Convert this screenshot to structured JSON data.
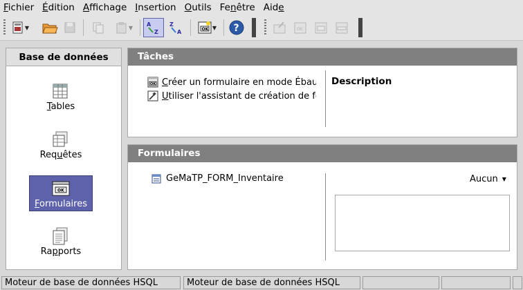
{
  "menubar": {
    "items": [
      {
        "pre": "",
        "u": "F",
        "post": "ichier"
      },
      {
        "pre": "",
        "u": "É",
        "post": "dition"
      },
      {
        "pre": "",
        "u": "A",
        "post": "ffichage"
      },
      {
        "pre": "",
        "u": "I",
        "post": "nsertion"
      },
      {
        "pre": "",
        "u": "O",
        "post": "utils"
      },
      {
        "pre": "Fe",
        "u": "n",
        "post": "être"
      },
      {
        "pre": "Aid",
        "u": "e",
        "post": ""
      }
    ]
  },
  "sidebar": {
    "title": "Base de données",
    "items": [
      {
        "pre": "",
        "u": "T",
        "post": "ables",
        "icon": "tables-icon"
      },
      {
        "pre": "Req",
        "u": "u",
        "post": "êtes",
        "icon": "queries-icon"
      },
      {
        "pre": "",
        "u": "F",
        "post": "ormulaires",
        "icon": "forms-icon",
        "selected": true
      },
      {
        "pre": "Ra",
        "u": "p",
        "post": "ports",
        "icon": "reports-icon"
      }
    ]
  },
  "tasks": {
    "title": "Tâches",
    "items": [
      {
        "u": "C",
        "rest": "réer un formulaire en mode Ébauche...",
        "icon": "form-design-icon"
      },
      {
        "u": "U",
        "rest": "tiliser l'assistant de création de formulaire...",
        "icon": "form-wizard-icon"
      }
    ],
    "description_title": "Description"
  },
  "forms": {
    "title": "Formulaires",
    "items": [
      {
        "label": "GeMaTP_FORM_Inventaire",
        "icon": "form-doc-icon"
      }
    ],
    "preview_mode": "Aucun"
  },
  "statusbar": {
    "cells": [
      "Moteur de base de données HSQL",
      "Moteur de base de données HSQL",
      "",
      "",
      ""
    ]
  },
  "colors": {
    "selection": "#5d62ab",
    "header_grey": "#808080"
  }
}
